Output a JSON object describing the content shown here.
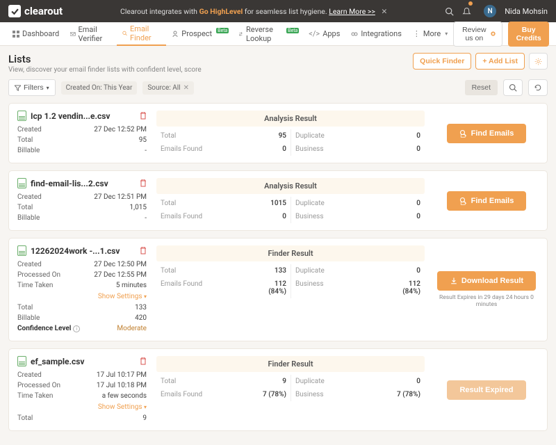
{
  "announce": {
    "prefix": "Clearout integrates with ",
    "brand": "Go HighLevel",
    "suffix": " for seamless list hygiene. ",
    "link": "Learn More >>"
  },
  "user": {
    "initial": "N",
    "name": "Nida Mohsin"
  },
  "nav": {
    "dashboard": "Dashboard",
    "email_verifier": "Email Verifier",
    "email_finder": "Email Finder",
    "prospect": "Prospect",
    "reverse_lookup": "Reverse Lookup",
    "apps": "Apps",
    "integrations": "Integrations",
    "more": "More",
    "beta": "Beta",
    "review": "Review us on",
    "buy": "Buy Credits"
  },
  "page": {
    "title": "Lists",
    "sub": "View, discover your email finder lists with confident level, score",
    "quick_finder": "Quick Finder",
    "add_list": "+ Add List"
  },
  "filters": {
    "label": "Filters",
    "chip_created": "Created On: This Year",
    "chip_source": "Source: All",
    "reset": "Reset"
  },
  "labels": {
    "created": "Created",
    "total": "Total",
    "billable": "Billable",
    "processed_on": "Processed On",
    "time_taken": "Time Taken",
    "confidence": "Confidence Level",
    "show_settings": "Show Settings",
    "analysis_result": "Analysis Result",
    "finder_result": "Finder Result",
    "emails_found": "Emails Found",
    "duplicate": "Duplicate",
    "business": "Business",
    "find_emails": "Find Emails",
    "download_result": "Download Result",
    "result_expired": "Result Expired"
  },
  "lists": [
    {
      "name": "Icp 1.2 vendin...e.csv",
      "created": "27 Dec 12:52 PM",
      "total": "95",
      "billable": "-",
      "result_type": "analysis",
      "r_total": "95",
      "r_emails": "0",
      "r_dup": "0",
      "r_bus": "0",
      "action": "find"
    },
    {
      "name": "find-email-lis...2.csv",
      "created": "27 Dec 12:51 PM",
      "total": "1,015",
      "billable": "-",
      "result_type": "analysis",
      "r_total": "1015",
      "r_emails": "0",
      "r_dup": "0",
      "r_bus": "0",
      "action": "find"
    },
    {
      "name": "12262024work -...1.csv",
      "created": "27 Dec 12:50 PM",
      "processed": "27 Dec 12:55 PM",
      "time_taken": "5 minutes",
      "total": "133",
      "billable": "420",
      "confidence": "Moderate",
      "show_settings": true,
      "result_type": "finder",
      "r_total": "133",
      "r_emails": "112 (84%)",
      "r_dup": "0",
      "r_bus": "112 (84%)",
      "action": "download",
      "expire_note": "Result Expires in 29 days 24 hours 0 minutes"
    },
    {
      "name": "ef_sample.csv",
      "created": "17 Jul 10:17 PM",
      "processed": "17 Jul 10:18 PM",
      "time_taken": "a few seconds",
      "total": "9",
      "show_settings": true,
      "result_type": "finder",
      "r_total": "9",
      "r_emails": "7 (78%)",
      "r_dup": "0",
      "r_bus": "7 (78%)",
      "action": "expired"
    }
  ]
}
